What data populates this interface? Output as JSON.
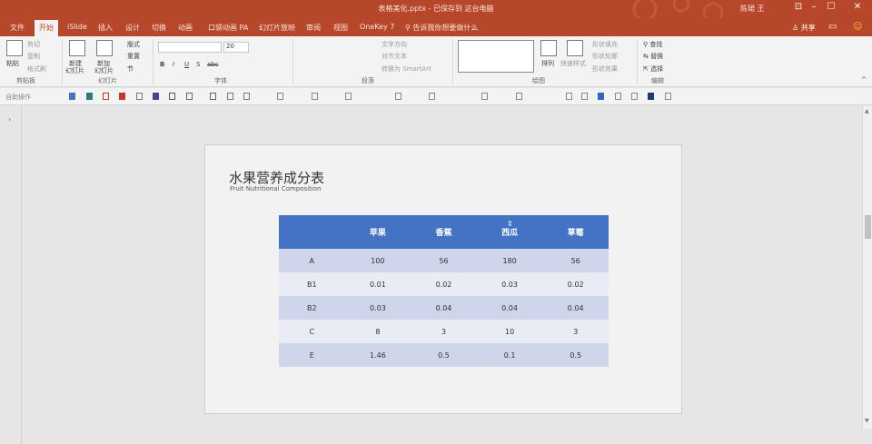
{
  "titlebar": {
    "document_title": "表格美化.pptx - 已保存到 这台电脑",
    "user": "陈珺 王",
    "ribbon_display_glyph": "⊡",
    "minimize_glyph": "–",
    "maximize_glyph": "☐",
    "close_glyph": "✕"
  },
  "tabs": {
    "file": "文件",
    "home": "开始",
    "islide": "iSlide",
    "insert": "插入",
    "design": "设计",
    "transitions": "切换",
    "animations": "动画",
    "pa": "口袋动画 PA",
    "slideshow": "幻灯片放映",
    "review": "审阅",
    "view": "视图",
    "onekey": "OneKey 7",
    "tell_me": "告诉我你想要做什么",
    "share": "共享"
  },
  "ribbon": {
    "clipboard": {
      "paste": "粘贴",
      "cut": "剪切",
      "copy": "复制",
      "format_painter": "格式刷",
      "group": "剪贴板"
    },
    "slides": {
      "new_slide_l1": "新建",
      "new_slide_l2": "幻灯片",
      "reuse_l1": "新加",
      "reuse_l2": "幻灯片",
      "layout": "版式",
      "reset": "重置",
      "section": "节",
      "group": "幻灯片"
    },
    "font": {
      "font_size": "20",
      "bold": "B",
      "italic": "I",
      "underline": "U",
      "shadow": "S",
      "strike": "abc",
      "group": "字体"
    },
    "paragraph": {
      "text_direction": "文字方向",
      "align_text": "对齐文本",
      "smartart": "转换为 SmartArt",
      "group": "段落"
    },
    "drawing": {
      "arrange": "排列",
      "quick_styles": "快速样式",
      "shape_fill": "形状填充",
      "shape_outline": "形状轮廓",
      "shape_effects": "形状效果",
      "group": "绘图"
    },
    "editing": {
      "find": "查找",
      "replace": "替换",
      "select": "选择",
      "group": "编辑"
    }
  },
  "qat": {
    "label": "自助操作"
  },
  "slide": {
    "title": "水果营养成分表",
    "subtitle": "Fruit Nutritional Composition",
    "table": {
      "headers": [
        "",
        "苹果",
        "香蕉",
        "西瓜",
        "草莓"
      ],
      "rows": [
        [
          "A",
          "100",
          "56",
          "180",
          "56"
        ],
        [
          "B1",
          "0.01",
          "0.02",
          "0.03",
          "0.02"
        ],
        [
          "B2",
          "0.03",
          "0.04",
          "0.04",
          "0.04"
        ],
        [
          "C",
          "8",
          "3",
          "10",
          "3"
        ],
        [
          "E",
          "1.46",
          "0.5",
          "0.1",
          "0.5"
        ]
      ]
    }
  },
  "colors": {
    "ribbon_red": "#b7472a",
    "table_header": "#4472c4",
    "row_odd": "#cfd5ea",
    "row_even": "#e9ebf5"
  }
}
